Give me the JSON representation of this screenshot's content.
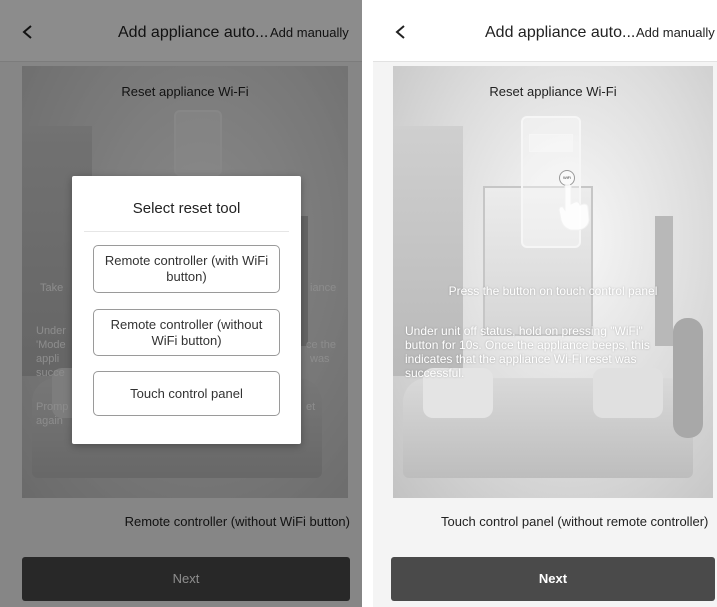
{
  "left_screen": {
    "header": {
      "title": "Add appliance auto...",
      "action": "Add manually"
    },
    "card": {
      "heading": "Reset appliance Wi-Fi",
      "partial_texts": [
        "Take",
        "iance",
        "Under",
        "'Mode",
        "ce the",
        "appli",
        "was",
        "succe",
        "Promp",
        "et",
        "again"
      ]
    },
    "caption": "Remote controller (without WiFi button)",
    "next_label": "Next",
    "modal": {
      "title": "Select reset tool",
      "options": [
        "Remote controller (with WiFi button)",
        "Remote controller (without WiFi button)",
        "Touch control panel"
      ]
    }
  },
  "right_screen": {
    "header": {
      "title": "Add appliance auto...",
      "action": "Add manually"
    },
    "card": {
      "heading": "Reset appliance Wi-Fi",
      "wifi_button_label": "WiFi",
      "press_text": "Press the button on touch control panel",
      "instruction": "Under unit off status, hold on pressing \"WiFi\" button for 10s. Once the appliance beeps, this indicates that the appliance Wi-Fi reset was successful."
    },
    "caption": "Touch control panel (without remote controller)",
    "next_label": "Next"
  },
  "colors": {
    "next_button": "#4a4a4a",
    "dim_overlay": "rgba(0,0,0,0.45)",
    "modal_bg": "#ffffff"
  },
  "icons": [
    "chevron-left-icon",
    "finger-press-icon"
  ]
}
